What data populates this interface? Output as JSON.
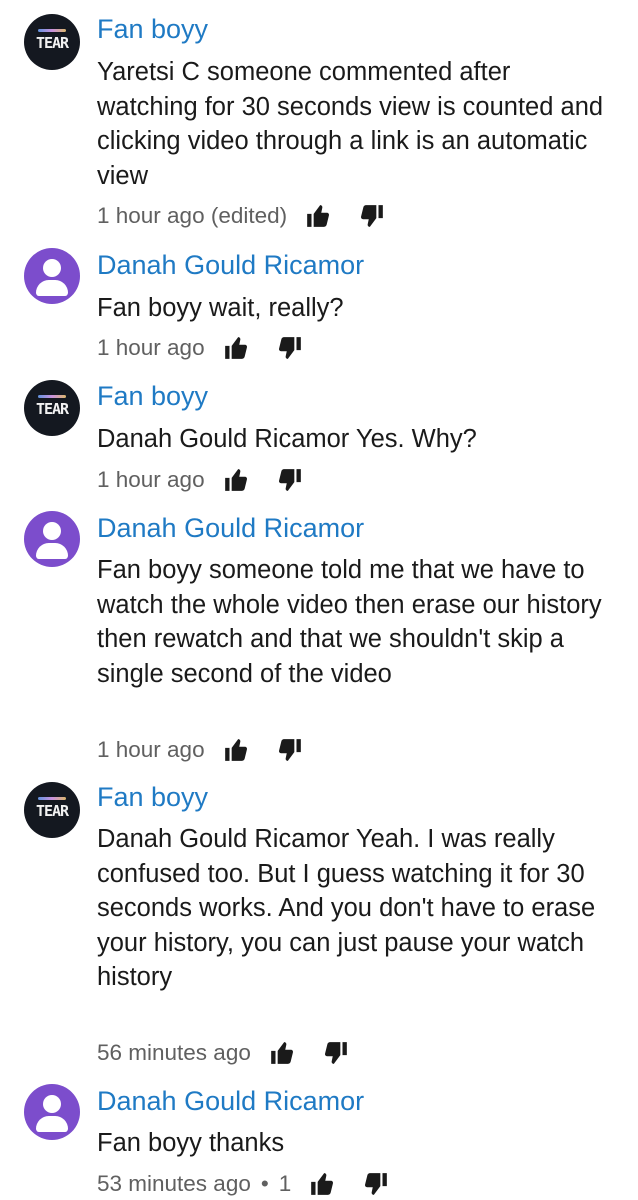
{
  "comments": [
    {
      "author": "Fan boyy",
      "avatar": "tear-logo",
      "avatar_text": "TEAR",
      "text": "Yaretsi C someone commented after watching for 30 seconds view is counted and clicking video through a link is an automatic view",
      "time": "1 hour ago (edited)",
      "likes": ""
    },
    {
      "author": "Danah Gould Ricamor",
      "avatar": "person-icon",
      "text": "Fan boyy wait, really?",
      "time": "1 hour ago",
      "likes": ""
    },
    {
      "author": "Fan boyy",
      "avatar": "tear-logo",
      "avatar_text": "TEAR",
      "text": "Danah Gould Ricamor Yes.  Why?",
      "time": "1 hour ago",
      "likes": ""
    },
    {
      "author": "Danah Gould Ricamor",
      "avatar": "person-icon",
      "text": "Fan boyy someone told me that we have to watch the whole video then erase our history then rewatch and that we shouldn't skip a single second of the video",
      "time": "1 hour ago",
      "likes": ""
    },
    {
      "author": "Fan boyy",
      "avatar": "tear-logo",
      "avatar_text": "TEAR",
      "text": "Danah Gould Ricamor Yeah.  I was really confused too. But I guess watching it for 30 seconds works. And you don't have to erase your history, you can just pause your watch history",
      "time": "56 minutes ago",
      "likes": ""
    },
    {
      "author": "Danah Gould Ricamor",
      "avatar": "person-icon",
      "text": "Fan boyy thanks",
      "time": "53 minutes ago",
      "separator": "•",
      "likes": "1"
    }
  ],
  "colors": {
    "author": "#1f7ac4",
    "text": "#1a1a1a",
    "meta": "#606060",
    "person_avatar": "#7c4dcc",
    "tear_avatar": "#141820"
  },
  "icons": {
    "like": "thumbs-up-icon",
    "dislike": "thumbs-down-icon"
  }
}
